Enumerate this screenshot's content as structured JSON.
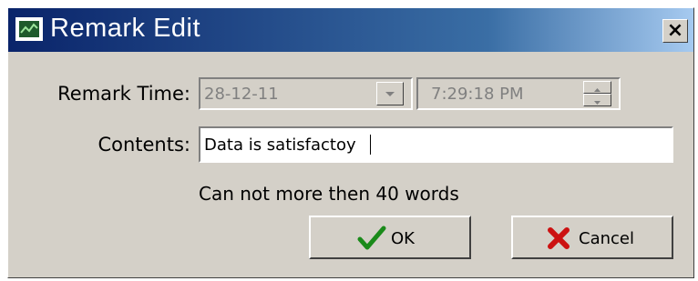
{
  "window": {
    "title": "Remark Edit",
    "close_glyph": "×",
    "icon": "trend-chart-icon"
  },
  "remark_time": {
    "label": "Remark Time:",
    "date_value": "28-12-11",
    "time_value": "7:29:18 PM"
  },
  "contents": {
    "label": "Contents:",
    "value": "Data is satisfactoy"
  },
  "hint": "Can not more then 40 words",
  "buttons": {
    "ok_label": "OK",
    "cancel_label": "Cancel"
  },
  "colors": {
    "titlebar_start": "#0a246a",
    "titlebar_end": "#a6caf0",
    "dialog_face": "#d4d0c8",
    "ok_check": "#1a8a1a",
    "cancel_x": "#cc1111"
  }
}
